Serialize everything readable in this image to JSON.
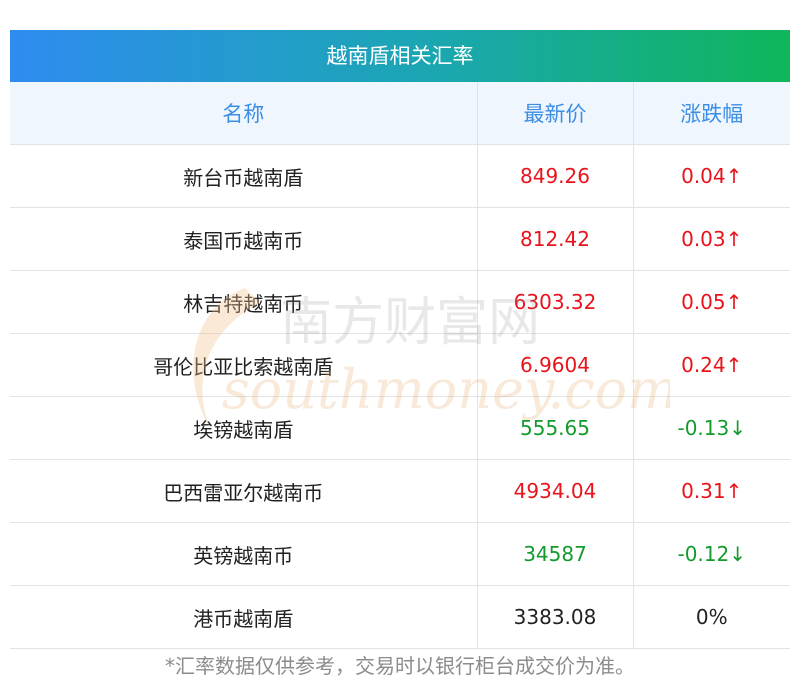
{
  "title": "越南盾相关汇率",
  "headers": [
    "名称",
    "最新价",
    "涨跌幅"
  ],
  "rows": [
    {
      "name": "新台币越南盾",
      "price": "849.26",
      "change": "0.04↑",
      "trend": "up"
    },
    {
      "name": "泰国币越南币",
      "price": "812.42",
      "change": "0.03↑",
      "trend": "up"
    },
    {
      "name": "林吉特越南币",
      "price": "6303.32",
      "change": "0.05↑",
      "trend": "up"
    },
    {
      "name": "哥伦比亚比索越南盾",
      "price": "6.9604",
      "change": "0.24↑",
      "trend": "up"
    },
    {
      "name": "埃镑越南盾",
      "price": "555.65",
      "change": "-0.13↓",
      "trend": "down"
    },
    {
      "name": "巴西雷亚尔越南币",
      "price": "4934.04",
      "change": "0.31↑",
      "trend": "up"
    },
    {
      "name": "英镑越南币",
      "price": "34587",
      "change": "-0.12↓",
      "trend": "down"
    },
    {
      "name": "港币越南盾",
      "price": "3383.08",
      "change": "0%",
      "trend": "flat"
    }
  ],
  "watermark": {
    "cn": "南方财富网",
    "en": "southmoney.com"
  },
  "note": "*汇率数据仅供参考，交易时以银行柜台成交价为准。",
  "colors": {
    "up": "#e8131b",
    "down": "#159a2e",
    "header_text": "#3a8ee6",
    "gradient_start": "#2f8cf0",
    "gradient_end": "#10b65a"
  }
}
